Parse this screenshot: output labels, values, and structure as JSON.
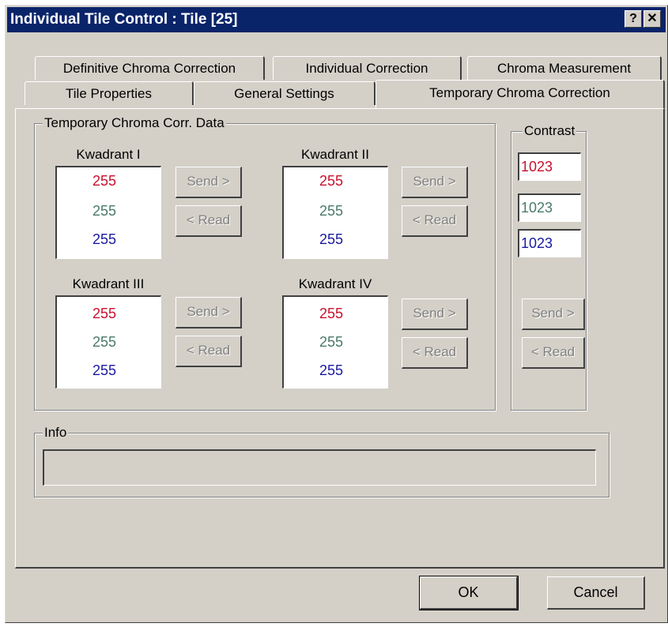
{
  "window": {
    "title": "Individual Tile Control : Tile [25]",
    "help_label": "?",
    "close_label": "✕"
  },
  "tabs": {
    "row1": [
      "Definitive Chroma Correction",
      "Individual Correction",
      "Chroma Measurement"
    ],
    "row2": [
      "Tile Properties",
      "General Settings",
      "Temporary Chroma Correction"
    ],
    "active": "Temporary Chroma Correction"
  },
  "chroma_group": {
    "label": "Temporary Chroma Corr. Data",
    "quadrants": [
      {
        "label": "Kwadrant I",
        "red": "255",
        "green": "255",
        "blue": "255"
      },
      {
        "label": "Kwadrant II",
        "red": "255",
        "green": "255",
        "blue": "255"
      },
      {
        "label": "Kwadrant III",
        "red": "255",
        "green": "255",
        "blue": "255"
      },
      {
        "label": "Kwadrant IV",
        "red": "255",
        "green": "255",
        "blue": "255"
      }
    ],
    "send_label": "Send >",
    "read_label": "< Read"
  },
  "contrast_group": {
    "label": "Contrast",
    "red": "1023",
    "green": "1023",
    "blue": "1023",
    "send_label": "Send >",
    "read_label": "< Read"
  },
  "info_group": {
    "label": "Info",
    "value": ""
  },
  "footer": {
    "ok_label": "OK",
    "cancel_label": "Cancel"
  },
  "colors": {
    "red": "#c8102e",
    "green": "#4a7a6a",
    "blue": "#1a1aa0",
    "titlebar": "#0a246a",
    "face": "#d4d0c8"
  }
}
